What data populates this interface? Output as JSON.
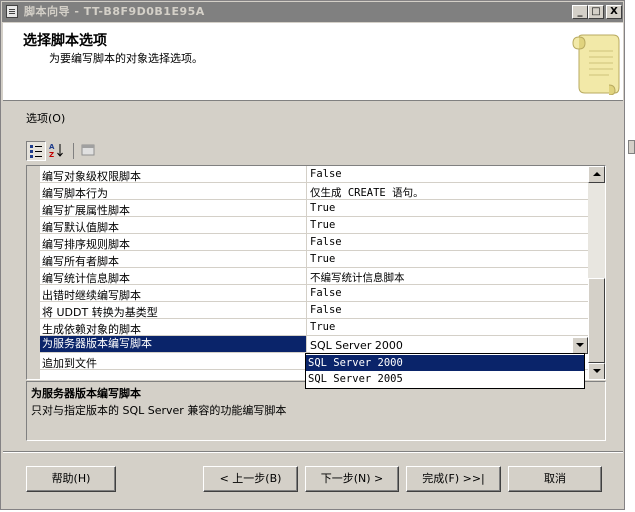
{
  "window": {
    "title": "脚本向导 - TT-B8F9D0B1E95A",
    "minimize": "_",
    "maximize": "□",
    "close": "X"
  },
  "header": {
    "title": "选择脚本选项",
    "subtitle": "为要编写脚本的对象选择选项。"
  },
  "options_label": "选项(O)",
  "toolbar": {
    "categorized_icon": "categorized-icon",
    "alphabetical_icon": "sort-alphabetical-icon",
    "property_pages_icon": "property-pages-icon"
  },
  "grid": {
    "rows": [
      {
        "name": "编写对象级权限脚本",
        "value": "False"
      },
      {
        "name": "编写脚本行为",
        "value": "仅生成 CREATE 语句。"
      },
      {
        "name": "编写扩展属性脚本",
        "value": "True"
      },
      {
        "name": "编写默认值脚本",
        "value": "True"
      },
      {
        "name": "编写排序规则脚本",
        "value": "False"
      },
      {
        "name": "编写所有者脚本",
        "value": "True"
      },
      {
        "name": "编写统计信息脚本",
        "value": "不编写统计信息脚本"
      },
      {
        "name": "出错时继续编写脚本",
        "value": "False"
      },
      {
        "name": "将 UDDT 转换为基类型",
        "value": "False"
      },
      {
        "name": "生成依赖对象的脚本",
        "value": "True"
      },
      {
        "name": "为服务器版本编写脚本",
        "value": "SQL Server 2000"
      },
      {
        "name": "追加到文件",
        "value": ""
      }
    ]
  },
  "dropdown": {
    "options": [
      "SQL Server 2000",
      "SQL Server 2005"
    ],
    "selected": "SQL Server 2000"
  },
  "description": {
    "title": "为服务器版本编写脚本",
    "text": "只对与指定版本的 SQL Server 兼容的功能编写脚本"
  },
  "buttons": {
    "help": "帮助(H)",
    "back": "< 上一步(B)",
    "next": "下一步(N) >",
    "finish": "完成(F) >>|",
    "cancel": "取消"
  }
}
